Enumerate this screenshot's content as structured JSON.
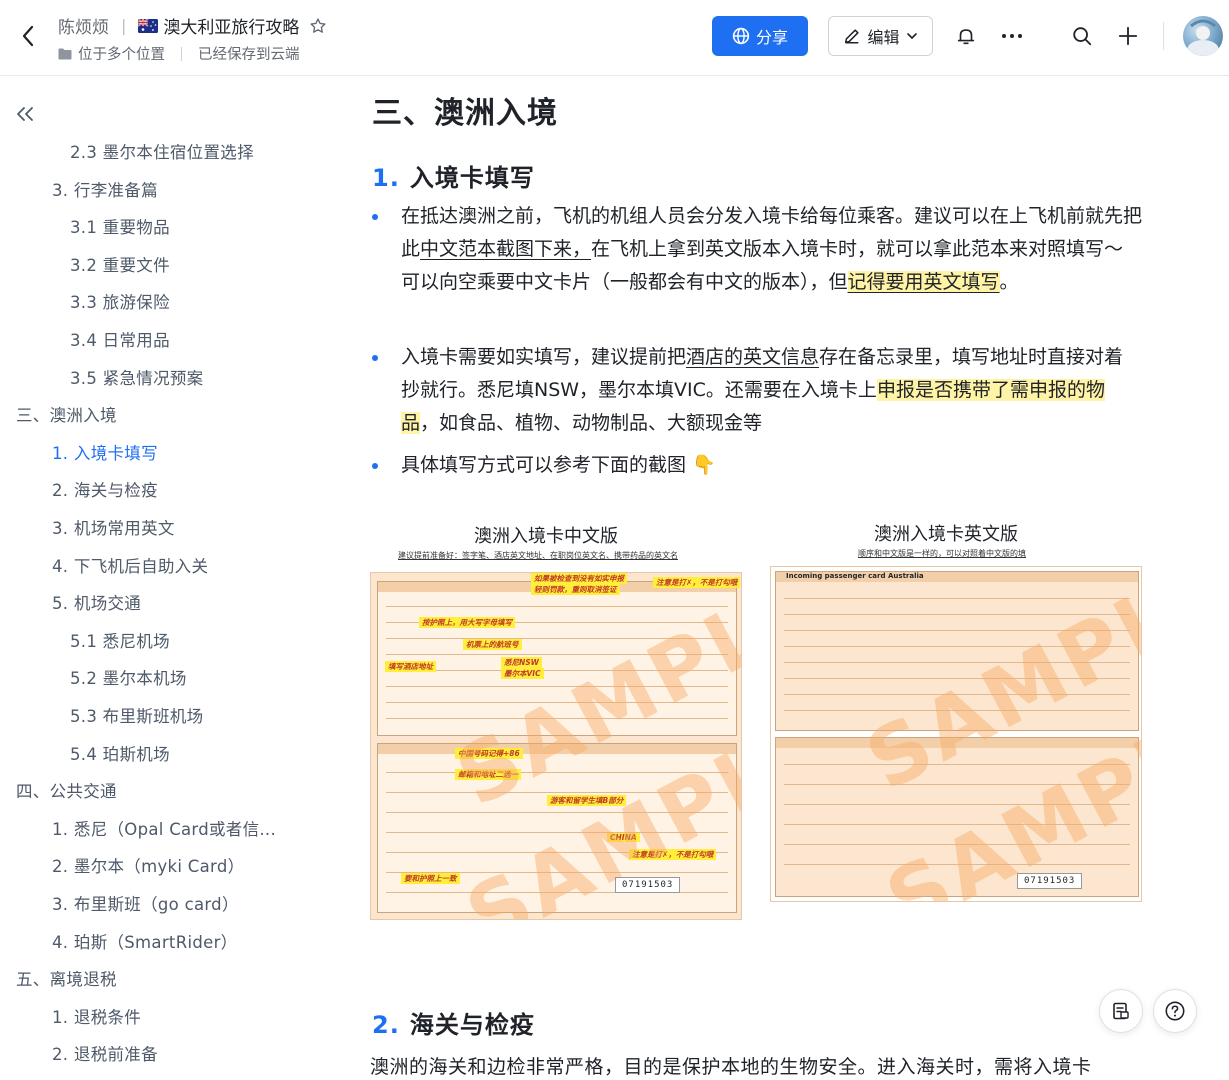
{
  "header": {
    "parent_crumb": "陈烦烦",
    "doc_title": "澳大利亚旅行攻略",
    "location_text": "位于多个位置",
    "save_status": "已经保存到云端",
    "share_label": "分享",
    "edit_label": "编辑"
  },
  "toc": [
    {
      "label": "2.3 墨尔本住宿位置选择",
      "level": 3
    },
    {
      "label": "3. 行李准备篇",
      "level": 2
    },
    {
      "label": "3.1 重要物品",
      "level": 3
    },
    {
      "label": "3.2 重要文件",
      "level": 3
    },
    {
      "label": "3.3 旅游保险",
      "level": 3
    },
    {
      "label": "3.4 日常用品",
      "level": 3
    },
    {
      "label": "3.5 紧急情况预案",
      "level": 3
    },
    {
      "label": "三、澳洲入境",
      "level": 1
    },
    {
      "label": "1. 入境卡填写",
      "level": 2,
      "active": true
    },
    {
      "label": "2. 海关与检疫",
      "level": 2
    },
    {
      "label": "3. 机场常用英文",
      "level": 2
    },
    {
      "label": "4. 下飞机后自助入关",
      "level": 2
    },
    {
      "label": "5. 机场交通",
      "level": 2
    },
    {
      "label": "5.1 悉尼机场",
      "level": 3
    },
    {
      "label": "5.2 墨尔本机场",
      "level": 3
    },
    {
      "label": "5.3 布里斯班机场",
      "level": 3
    },
    {
      "label": "5.4 珀斯机场",
      "level": 3
    },
    {
      "label": "四、公共交通",
      "level": 1
    },
    {
      "label": "1. 悉尼（Opal Card或者信...",
      "level": 2
    },
    {
      "label": "2. 墨尔本（myki Card）",
      "level": 2
    },
    {
      "label": "3. 布里斯班（go card）",
      "level": 2
    },
    {
      "label": "4. 珀斯（SmartRider）",
      "level": 2
    },
    {
      "label": "五、离境退税",
      "level": 1
    },
    {
      "label": "1. 退税条件",
      "level": 2
    },
    {
      "label": "2. 退税前准备",
      "level": 2
    }
  ],
  "content": {
    "h1": "三、澳洲入境",
    "section1": {
      "num": "1.",
      "title": "入境卡填写"
    },
    "p1": {
      "a": "在抵达澳洲之前，飞机的机组人员会分发入境卡给每位乘客。建议可以在上飞机前就先把此",
      "b": "中文范本截图下来，",
      "c": "在飞机上拿到英文版本入境卡时，就可以拿此范本来对照填写～可以向空乘要中文卡片（一般都会有中文的版本），但",
      "d": "记得要用英文填写",
      "e": "。"
    },
    "p2": {
      "a": "入境卡需要如实填写，建议提前把",
      "b": "酒店的英文信息",
      "c": "存在备忘录里，填写地址时直接对着抄就行。悉尼填NSW，墨尔本填VIC。还需要在入境卡上",
      "d": "申报是否携带了需申报的物品",
      "e": "，如食品、植物、动物制品、大额现金等"
    },
    "p3": "具体填写方式可以参考下面的截图 👇",
    "card_cn": {
      "title": "澳洲入境卡中文版",
      "subtitle": "建议提前准备好：签字笔、酒店英文地址、在职岗位英文名、携带药品的英文名",
      "number": "07191503",
      "notes": [
        "如果被检查到没有如实申报",
        "轻则罚款，重则取消签证",
        "注意是打✗，不是打勾哦",
        "按护照上，用大写字母填写",
        "机票上的航班号",
        "填写酒店地址",
        "悉尼NSW",
        "墨尔本VIC",
        "中国号码记得+86",
        "邮箱和地址二选一",
        "游客和留学生填B部分",
        "CHINA",
        "注意是打✗，不是打勾哦",
        "要和护照上一致"
      ],
      "watermark": "SAMPLE"
    },
    "card_en": {
      "title": "澳洲入境卡英文版",
      "subtitle": "顺序和中文版是一样的，可以对照着中文版的填",
      "number": "07191503",
      "form_header": "Incoming passenger card",
      "form_country": "Australia",
      "watermark": "SAMPLE"
    },
    "section2": {
      "num": "2.",
      "title": "海关与检疫"
    },
    "p4": "澳洲的海关和边检非常严格，目的是保护本地的生物安全。进入海关时，需将入境卡"
  },
  "colors": {
    "accent": "#1f6ff2",
    "highlight": "#fff3a6",
    "card_bg": "#fde6cf"
  }
}
